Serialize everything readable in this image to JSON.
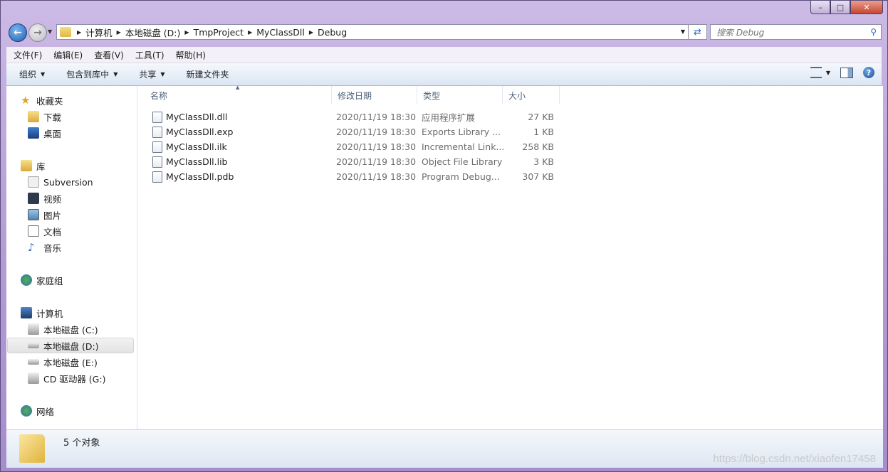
{
  "window": {
    "title": ""
  },
  "nav": {
    "breadcrumbs": [
      "计算机",
      "本地磁盘 (D:)",
      "TmpProject",
      "MyClassDll",
      "Debug"
    ],
    "search_placeholder": "搜索 Debug"
  },
  "menubar": [
    "文件(F)",
    "编辑(E)",
    "查看(V)",
    "工具(T)",
    "帮助(H)"
  ],
  "commands": {
    "organize": "组织",
    "include_library": "包含到库中",
    "share": "共享",
    "new_folder": "新建文件夹"
  },
  "sidebar": {
    "favorites": {
      "label": "收藏夹",
      "items": [
        "下载",
        "桌面"
      ]
    },
    "libraries": {
      "label": "库",
      "items": [
        "Subversion",
        "视频",
        "图片",
        "文档",
        "音乐"
      ]
    },
    "homegroup": "家庭组",
    "computer": {
      "label": "计算机",
      "items": [
        "本地磁盘 (C:)",
        "本地磁盘 (D:)",
        "本地磁盘 (E:)",
        "CD 驱动器 (G:)"
      ],
      "selected": "本地磁盘 (D:)"
    },
    "network": "网络"
  },
  "columns": [
    "名称",
    "修改日期",
    "类型",
    "大小"
  ],
  "files": [
    {
      "name": "MyClassDll.dll",
      "date": "2020/11/19 18:30",
      "type": "应用程序扩展",
      "size": "27 KB"
    },
    {
      "name": "MyClassDll.exp",
      "date": "2020/11/19 18:30",
      "type": "Exports Library ...",
      "size": "1 KB"
    },
    {
      "name": "MyClassDll.ilk",
      "date": "2020/11/19 18:30",
      "type": "Incremental Link...",
      "size": "258 KB"
    },
    {
      "name": "MyClassDll.lib",
      "date": "2020/11/19 18:30",
      "type": "Object File Library",
      "size": "3 KB"
    },
    {
      "name": "MyClassDll.pdb",
      "date": "2020/11/19 18:30",
      "type": "Program Debug...",
      "size": "307 KB"
    }
  ],
  "status": {
    "count": "5 个对象"
  },
  "watermark": "https://blog.csdn.net/xiaofen17458"
}
